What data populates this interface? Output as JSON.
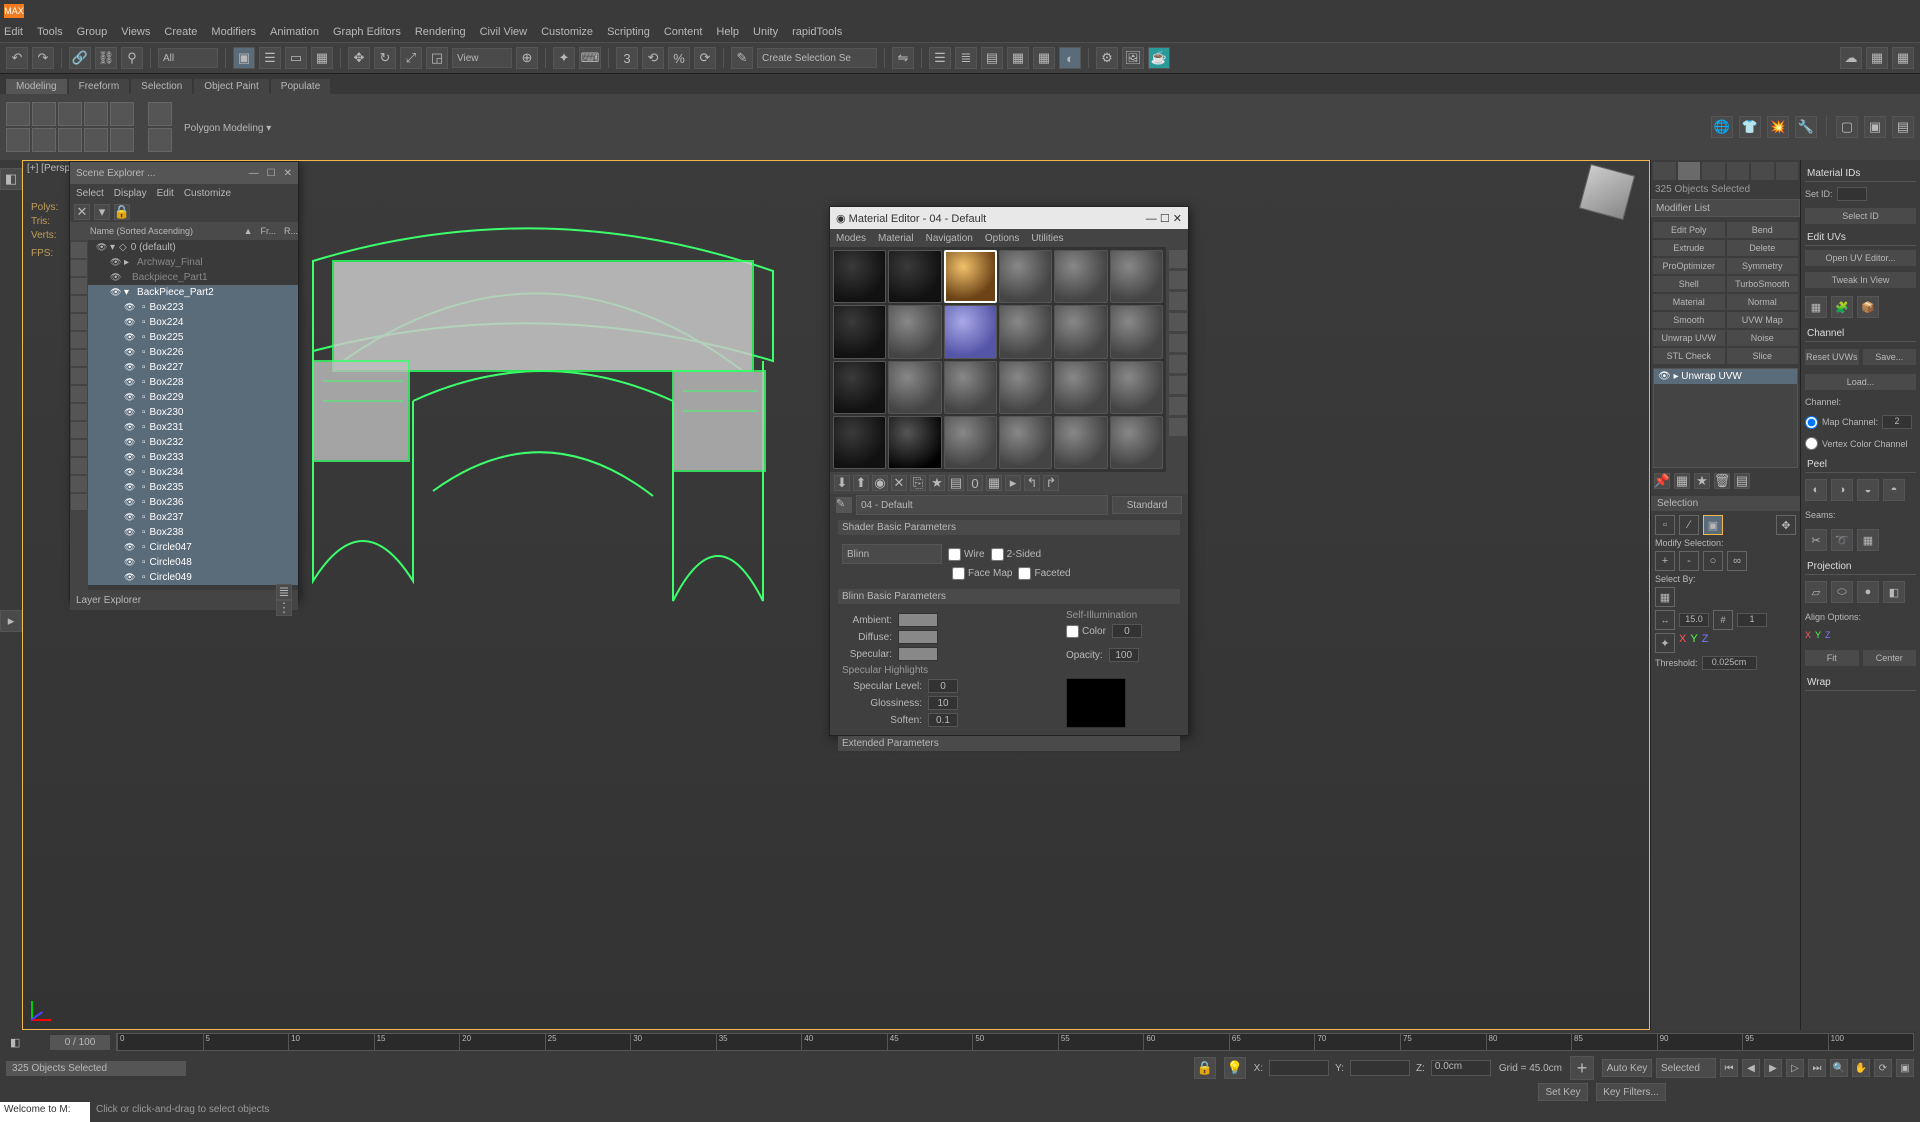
{
  "app": {
    "logo": "MAX"
  },
  "menu": [
    "Edit",
    "Tools",
    "Group",
    "Views",
    "Create",
    "Modifiers",
    "Animation",
    "Graph Editors",
    "Rendering",
    "Civil View",
    "Customize",
    "Scripting",
    "Content",
    "Help",
    "Unity",
    "rapidTools"
  ],
  "toolbar": {
    "all_filter": "All",
    "view_dd": "View",
    "selset_dd": "Create Selection Se"
  },
  "ribbon": {
    "tabs": [
      "Modeling",
      "Freeform",
      "Selection",
      "Object Paint",
      "Populate"
    ],
    "active": 0,
    "polymodeling": "Polygon Modeling  ▾"
  },
  "viewport": {
    "label": "[+] [Perspective]",
    "stats": {
      "polys": "Polys:",
      "tris": "Tris:",
      "verts": "Verts:",
      "fps": "FPS:"
    }
  },
  "scene_explorer": {
    "title": "Scene Explorer ...",
    "menus": [
      "Select",
      "Display",
      "Edit",
      "Customize"
    ],
    "columns": [
      "Name (Sorted Ascending)",
      "▲",
      "Fr...",
      "R..."
    ],
    "rows": [
      {
        "indent": 0,
        "expand": "▾",
        "icon": "◇",
        "name": "0 (default)",
        "sel": false
      },
      {
        "indent": 1,
        "expand": "▸",
        "icon": "",
        "name": "Archway_Final",
        "sel": false,
        "grey": true
      },
      {
        "indent": 1,
        "expand": "",
        "icon": "",
        "name": "Backpiece_Part1",
        "sel": false,
        "grey": true
      },
      {
        "indent": 1,
        "expand": "▾",
        "icon": "",
        "name": "BackPiece_Part2",
        "sel": true
      },
      {
        "indent": 2,
        "icon": "▫",
        "name": "Box223",
        "sel": true
      },
      {
        "indent": 2,
        "icon": "▫",
        "name": "Box224",
        "sel": true
      },
      {
        "indent": 2,
        "icon": "▫",
        "name": "Box225",
        "sel": true
      },
      {
        "indent": 2,
        "icon": "▫",
        "name": "Box226",
        "sel": true
      },
      {
        "indent": 2,
        "icon": "▫",
        "name": "Box227",
        "sel": true
      },
      {
        "indent": 2,
        "icon": "▫",
        "name": "Box228",
        "sel": true
      },
      {
        "indent": 2,
        "icon": "▫",
        "name": "Box229",
        "sel": true
      },
      {
        "indent": 2,
        "icon": "▫",
        "name": "Box230",
        "sel": true
      },
      {
        "indent": 2,
        "icon": "▫",
        "name": "Box231",
        "sel": true
      },
      {
        "indent": 2,
        "icon": "▫",
        "name": "Box232",
        "sel": true
      },
      {
        "indent": 2,
        "icon": "▫",
        "name": "Box233",
        "sel": true
      },
      {
        "indent": 2,
        "icon": "▫",
        "name": "Box234",
        "sel": true
      },
      {
        "indent": 2,
        "icon": "▫",
        "name": "Box235",
        "sel": true
      },
      {
        "indent": 2,
        "icon": "▫",
        "name": "Box236",
        "sel": true
      },
      {
        "indent": 2,
        "icon": "▫",
        "name": "Box237",
        "sel": true
      },
      {
        "indent": 2,
        "icon": "▫",
        "name": "Box238",
        "sel": true
      },
      {
        "indent": 2,
        "icon": "▫",
        "name": "Circle047",
        "sel": true
      },
      {
        "indent": 2,
        "icon": "▫",
        "name": "Circle048",
        "sel": true
      },
      {
        "indent": 2,
        "icon": "▫",
        "name": "Circle049",
        "sel": true
      }
    ],
    "footer": "Layer Explorer"
  },
  "mat_editor": {
    "title": "Material Editor - 04 - Default",
    "menus": [
      "Modes",
      "Material",
      "Navigation",
      "Options",
      "Utilities"
    ],
    "name": "04 - Default",
    "type_btn": "Standard",
    "rollouts": {
      "shader": {
        "header": "Shader Basic Parameters",
        "shader_dd": "Blinn",
        "wire": "Wire",
        "twoSided": "2-Sided",
        "faceMap": "Face Map",
        "faceted": "Faceted"
      },
      "blinn": {
        "header": "Blinn Basic Parameters",
        "selfillum": "Self-Illumination",
        "ambient": "Ambient:",
        "diffuse": "Diffuse:",
        "specular": "Specular:",
        "color": "Color",
        "opacity": "Opacity:",
        "opacity_val": "100",
        "highlights": "Specular Highlights",
        "speclevel": "Specular Level:",
        "speclevel_v": "0",
        "gloss": "Glossiness:",
        "gloss_v": "10",
        "soften": "Soften:",
        "soften_v": "0.1"
      },
      "ext": {
        "header": "Extended Parameters"
      }
    },
    "selfillum_val": "0"
  },
  "modify": {
    "objcount": "325 Objects Selected",
    "modlist": "Modifier List",
    "quick": [
      "Edit Poly",
      "Bend",
      "Extrude",
      "Delete",
      "ProOptimizer",
      "Symmetry",
      "Shell",
      "TurboSmooth",
      "Material",
      "Normal",
      "Smooth",
      "UVW Map",
      "Unwrap UVW",
      "Noise",
      "STL Check",
      "Slice"
    ],
    "stack": [
      "Unwrap UVW"
    ],
    "selection": {
      "header": "Selection",
      "modify_sel": "Modify Selection:",
      "select_by": "Select By:",
      "dist": "15.0",
      "count": "1",
      "threshold_l": "Threshold:",
      "threshold_v": "0.025cm"
    }
  },
  "rightpanel": {
    "matids": {
      "header": "Material IDs",
      "setid": "Set ID:",
      "selectid": "Select ID"
    },
    "edituvs": {
      "header": "Edit UVs",
      "open": "Open UV Editor...",
      "tweak": "Tweak In View"
    },
    "channel": {
      "header": "Channel",
      "reset": "Reset UVWs",
      "save": "Save...",
      "load": "Load...",
      "chan_label": "Channel:",
      "map_ch": "Map Channel:",
      "map_ch_v": "2",
      "vcc": "Vertex Color Channel"
    },
    "peel": {
      "header": "Peel",
      "seams": "Seams:"
    },
    "projection": {
      "header": "Projection",
      "align": "Align Options:",
      "fit": "Fit",
      "center": "Center"
    },
    "wrap": {
      "header": "Wrap"
    }
  },
  "timeline": {
    "range": "0 / 100",
    "ticks": [
      "0",
      "5",
      "10",
      "15",
      "20",
      "25",
      "30",
      "35",
      "40",
      "45",
      "50",
      "55",
      "60",
      "65",
      "70",
      "75",
      "80",
      "85",
      "90",
      "95",
      "100"
    ]
  },
  "status": {
    "selected": "325 Objects Selected",
    "x": "X:",
    "y": "Y:",
    "z": "Z:",
    "z_val": "0.0cm",
    "grid": "Grid = 45.0cm",
    "autokey": "Auto Key",
    "selected_dd": "Selected",
    "setkey": "Set Key",
    "keyfilters": "Key Filters..."
  },
  "prompt": {
    "welcome": "Welcome to M:",
    "hint": "Click or click-and-drag to select objects"
  }
}
